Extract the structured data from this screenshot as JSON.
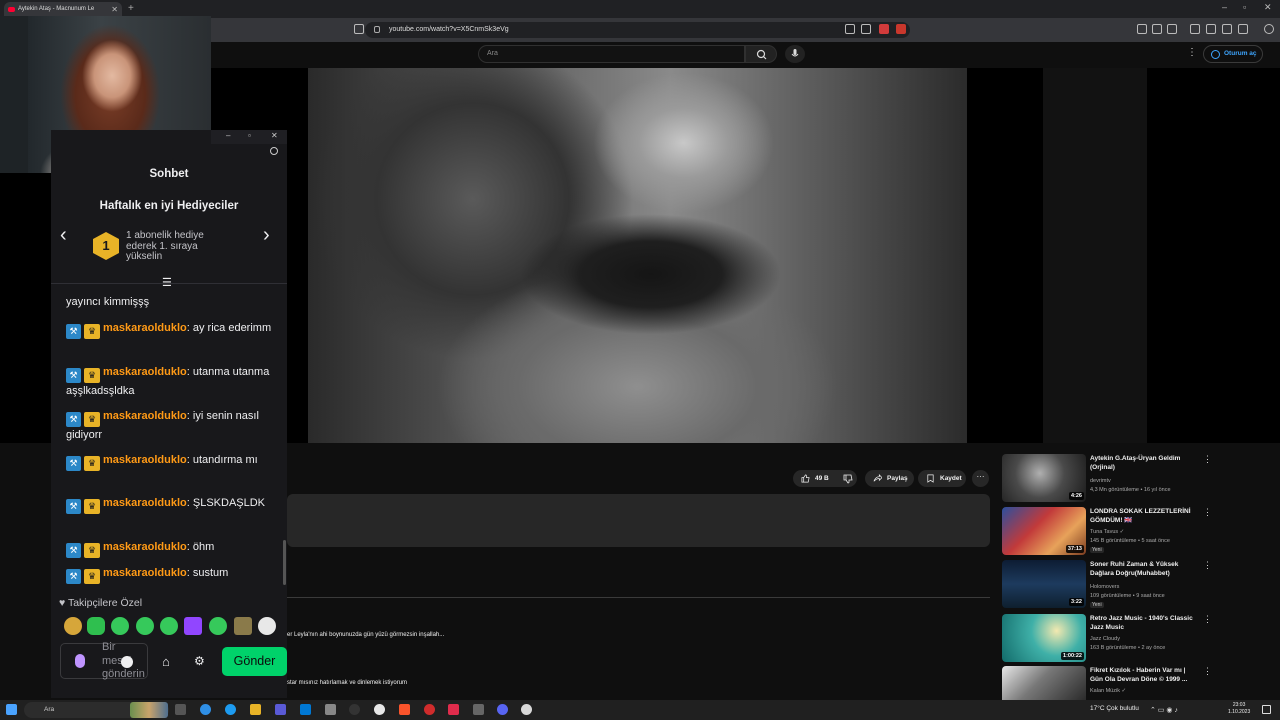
{
  "browser": {
    "tab_title": "Aytekin Ataş - Macnunum Le",
    "url": "youtube.com/watch?v=X5CnmSk3eVg",
    "new_tab": "+",
    "window_controls": [
      "–",
      "▫",
      "✕"
    ]
  },
  "youtube": {
    "search_placeholder": "Ara",
    "signin": "Oturum aç",
    "actions": {
      "like": "49 B",
      "share": "Paylaş",
      "save": "Kaydet",
      "more": "···"
    },
    "comments": [
      "er Leyla'nın ahi boynunuzda gün yüzü görmezsin inşallah...",
      "star mısınız hatırlamak ve dinlemek istiyorum"
    ],
    "recommendations": [
      {
        "title": "Aytekin G.Ataş-Üryan Geldim (Orjinal)",
        "channel": "devrimtv",
        "meta": "4,3 Mn görüntüleme • 16 yıl önce",
        "duration": "4:26",
        "badge": ""
      },
      {
        "title": "LONDRA SOKAK LEZZETLERİNİ GÖMDÜM! 🇬🇧",
        "channel": "Tuna Tavus ✓",
        "meta": "145 B görüntüleme • 5 saat önce",
        "duration": "37:13",
        "badge": "Yeni"
      },
      {
        "title": "Soner Ruhi Zaman & Yüksek Dağlara Doğru(Muhabbet)",
        "channel": "Holomovers",
        "meta": "109 görüntüleme • 9 saat önce",
        "duration": "3:22",
        "badge": "Yeni"
      },
      {
        "title": "Retro Jazz Music - 1940's Classic Jazz Music",
        "channel": "Jazz Cloudy",
        "meta": "163 B görüntüleme • 2 ay önce",
        "duration": "1:00:22",
        "badge": ""
      },
      {
        "title": "Fikret Kızılok - Haberin Var mı | Gün Ola Devran Döne © 1999 ...",
        "channel": "Kalan Müzik ✓",
        "meta": "",
        "duration": "",
        "badge": ""
      }
    ]
  },
  "chat": {
    "header": "Sohbet",
    "gifters_title": "Haftalık en iyi Hediyeciler",
    "rank": "1",
    "gift_text": "1 abonelik hediye ederek 1. sıraya yükselin",
    "messages": [
      {
        "user": "",
        "text": "yayıncı kimmişşş"
      },
      {
        "user": "maskaraolduklo",
        "text": ": ay rica ederimm"
      },
      {
        "user": "maskaraolduklo",
        "text": ": utanma utanma aşşlkadsşldka"
      },
      {
        "user": "maskaraolduklo",
        "text": ": iyi senin nasıl gidiyorr"
      },
      {
        "user": "maskaraolduklo",
        "text": ": utandırma mı"
      },
      {
        "user": "maskaraolduklo",
        "text": ": ŞLSKDAŞLDK"
      },
      {
        "user": "maskaraolduklo",
        "text": ": öhm"
      },
      {
        "user": "maskaraolduklo",
        "text": ": sustum"
      }
    ],
    "followers_label": "♥ Takipçilere Özel",
    "input_placeholder": "Bir mesaj gönderin",
    "send": "Gönder"
  },
  "taskbar": {
    "search": "Ara",
    "weather": "17°C  Çok bulutlu",
    "time": "23:03",
    "date": "1.10.2023"
  },
  "colors": {
    "send_button": "#00d26a",
    "username": "#ff9a16",
    "badge_gold": "#e8b327",
    "badge_blue": "#2c88c8"
  }
}
